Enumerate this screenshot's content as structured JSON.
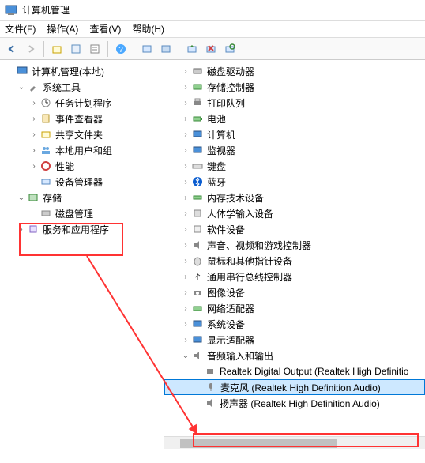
{
  "title": "计算机管理",
  "menu": {
    "file": "文件(F)",
    "action": "操作(A)",
    "view": "查看(V)",
    "help": "帮助(H)"
  },
  "left_tree": {
    "root": "计算机管理(本地)",
    "system_tools": "系统工具",
    "task_scheduler": "任务计划程序",
    "event_viewer": "事件查看器",
    "shared_folders": "共享文件夹",
    "local_users": "本地用户和组",
    "performance": "性能",
    "device_manager": "设备管理器",
    "storage": "存储",
    "disk_mgmt": "磁盘管理",
    "services_apps": "服务和应用程序"
  },
  "right_tree": {
    "disk_drives": "磁盘驱动器",
    "storage_controllers": "存储控制器",
    "print_queues": "打印队列",
    "batteries": "电池",
    "computer": "计算机",
    "monitors": "监视器",
    "keyboards": "键盘",
    "bluetooth": "蓝牙",
    "memory_devices": "内存技术设备",
    "hid": "人体学输入设备",
    "software_devices": "软件设备",
    "sound_video_game": "声音、视频和游戏控制器",
    "mice": "鼠标和其他指针设备",
    "usb_controllers": "通用串行总线控制器",
    "imaging_devices": "图像设备",
    "network_adapters": "网络适配器",
    "system_devices": "系统设备",
    "display_adapters": "显示适配器",
    "audio_io": "音频输入和输出",
    "realtek_digital": "Realtek Digital Output (Realtek High Definitio",
    "microphone": "麦克风 (Realtek High Definition Audio)",
    "speakers": "扬声器 (Realtek High Definition Audio)"
  }
}
